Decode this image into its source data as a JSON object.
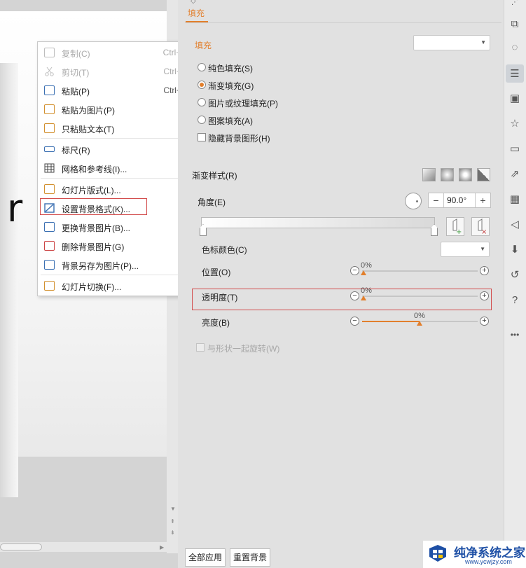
{
  "context_menu": {
    "items": [
      {
        "label": "复制(C)",
        "shortcut": "Ctrl+C",
        "disabled": true,
        "icon": "copy-icon"
      },
      {
        "label": "剪切(T)",
        "shortcut": "Ctrl+X",
        "disabled": true,
        "icon": "cut-icon"
      },
      {
        "label": "粘贴(P)",
        "shortcut": "Ctrl+V",
        "disabled": false,
        "icon": "paste-icon"
      },
      {
        "label": "粘贴为图片(P)",
        "shortcut": "",
        "disabled": false,
        "icon": "paste-as-image-icon"
      },
      {
        "label": "只粘贴文本(T)",
        "shortcut": "",
        "disabled": false,
        "icon": "paste-text-icon"
      },
      {
        "label": "标尺(R)",
        "shortcut": "",
        "disabled": false,
        "icon": "ruler-icon"
      },
      {
        "label": "网格和参考线(I)...",
        "shortcut": "",
        "disabled": false,
        "icon": "grid-icon"
      },
      {
        "label": "幻灯片版式(L)...",
        "shortcut": "",
        "disabled": false,
        "icon": "layout-icon"
      },
      {
        "label": "设置背景格式(K)...",
        "shortcut": "",
        "disabled": false,
        "icon": "background-format-icon"
      },
      {
        "label": "更换背景图片(B)...",
        "shortcut": "",
        "disabled": false,
        "icon": "change-background-icon"
      },
      {
        "label": "删除背景图片(G)",
        "shortcut": "",
        "disabled": false,
        "icon": "delete-background-icon"
      },
      {
        "label": "背景另存为图片(P)...",
        "shortcut": "",
        "disabled": false,
        "icon": "save-background-icon"
      },
      {
        "label": "幻灯片切换(F)...",
        "shortcut": "",
        "disabled": false,
        "icon": "transition-icon"
      }
    ]
  },
  "slide": {
    "visible_letter": "r"
  },
  "panel": {
    "tab_label": "填充",
    "fill_heading": "填充",
    "fill_options": [
      {
        "label": "纯色填充(S)",
        "selected": false
      },
      {
        "label": "渐变填充(G)",
        "selected": true
      },
      {
        "label": "图片或纹理填充(P)",
        "selected": false
      },
      {
        "label": "图案填充(A)",
        "selected": false
      }
    ],
    "hide_bg_shapes_label": "隐藏背景图形(H)",
    "gradient_style_label": "渐变样式(R)",
    "angle_label": "角度(E)",
    "angle_value": "90.0°",
    "stop_color_label": "色标颜色(C)",
    "position_label": "位置(O)",
    "position_value": "0%",
    "transparency_label": "透明度(T)",
    "transparency_value": "0%",
    "brightness_label": "亮度(B)",
    "brightness_value": "0%",
    "rotate_with_shape_label": "与形状一起旋转(W)",
    "apply_all_button": "全部应用",
    "reset_button": "重置背景"
  },
  "watermark": {
    "title": "纯净系统之家",
    "url": "www.ycwjzy.com"
  },
  "colors": {
    "accent": "#e27f2c",
    "highlight_border": "#d24b4b",
    "watermark_blue": "#1d4fa5"
  }
}
